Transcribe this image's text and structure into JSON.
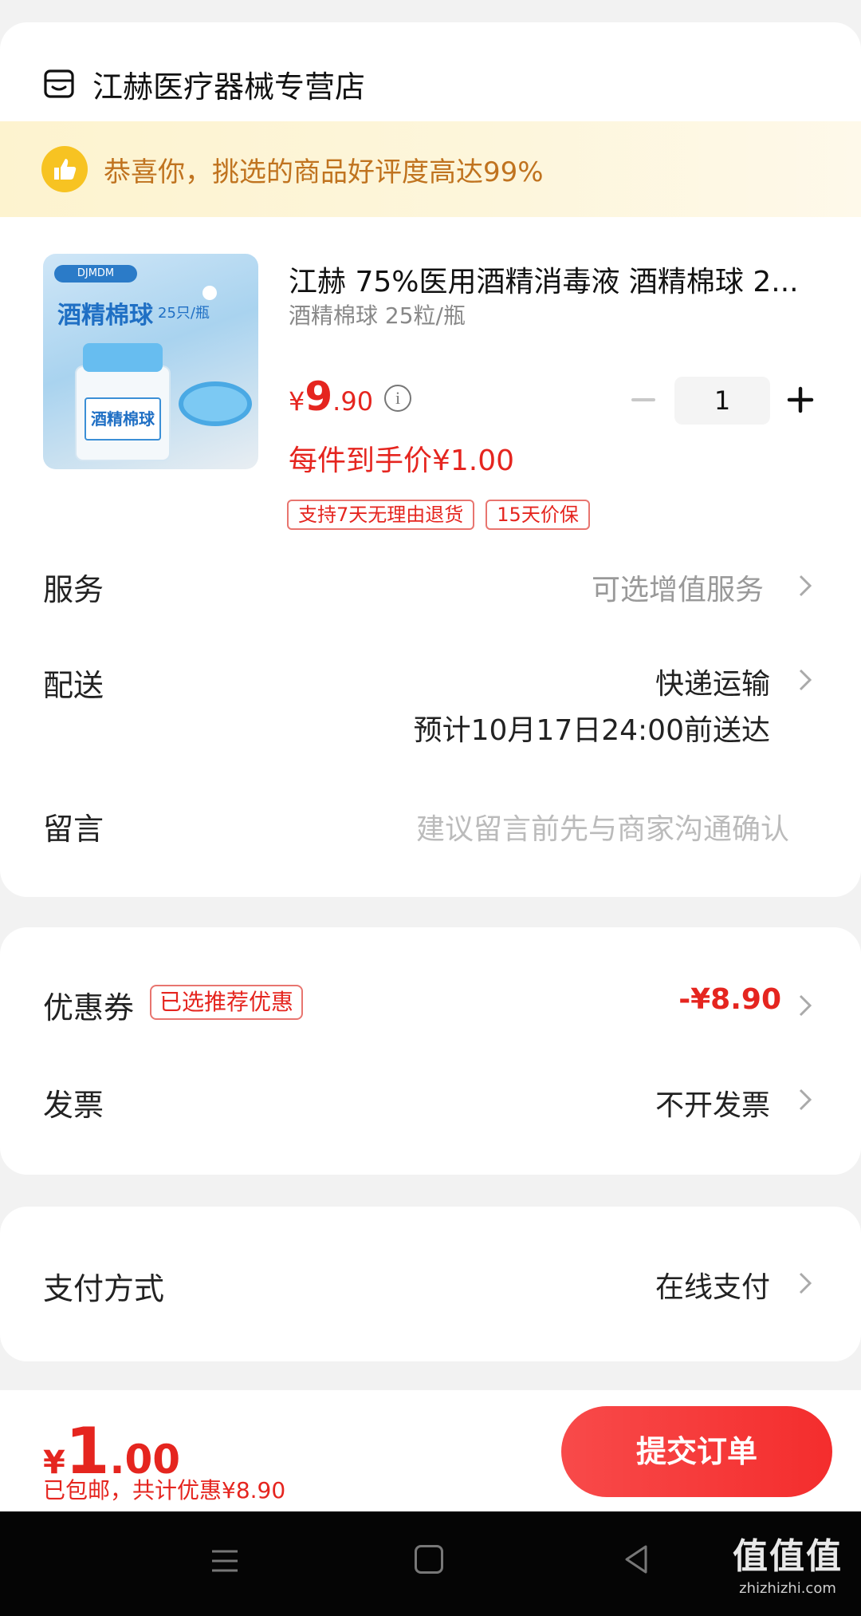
{
  "shop": {
    "name": "江赫医疗器械专营店"
  },
  "banner": {
    "text": "恭喜你，挑选的商品好评度高达99%"
  },
  "product": {
    "image_title": "酒精棉球",
    "image_subtitle": "25只/瓶",
    "image_brand": "DJMDM",
    "image_label": "酒精棉球",
    "title": "江赫 75%医用酒精消毒液 酒精棉球 2...",
    "spec": "酒精棉球 25粒/瓶",
    "price_currency": "¥",
    "price_int": "9",
    "price_dec": ".90",
    "quantity": "1",
    "net_price": "每件到手价¥1.00",
    "tags": [
      "支持7天无理由退货",
      "15天价保"
    ]
  },
  "rows": {
    "service_label": "服务",
    "service_value": "可选增值服务",
    "delivery_label": "配送",
    "delivery_value": "快递运输",
    "delivery_eta": "预计10月17日24:00前送达",
    "message_label": "留言",
    "message_placeholder": "建议留言前先与商家沟通确认",
    "coupon_label": "优惠券",
    "coupon_tag": "已选推荐优惠",
    "coupon_value": "-¥8.90",
    "invoice_label": "发票",
    "invoice_value": "不开发票",
    "payment_label": "支付方式",
    "payment_value": "在线支付"
  },
  "footer": {
    "total_currency": "¥",
    "total_int": "1",
    "total_dec": ".00",
    "note": "已包邮，共计优惠¥8.90",
    "submit_label": "提交订单"
  },
  "watermark": {
    "logo": "值值值",
    "url": "zhizhizhi.com"
  },
  "colors": {
    "accent": "#e5251f",
    "banner_bg": "#fdf3cf",
    "banner_text": "#c0731f",
    "button": "#f4393c"
  }
}
